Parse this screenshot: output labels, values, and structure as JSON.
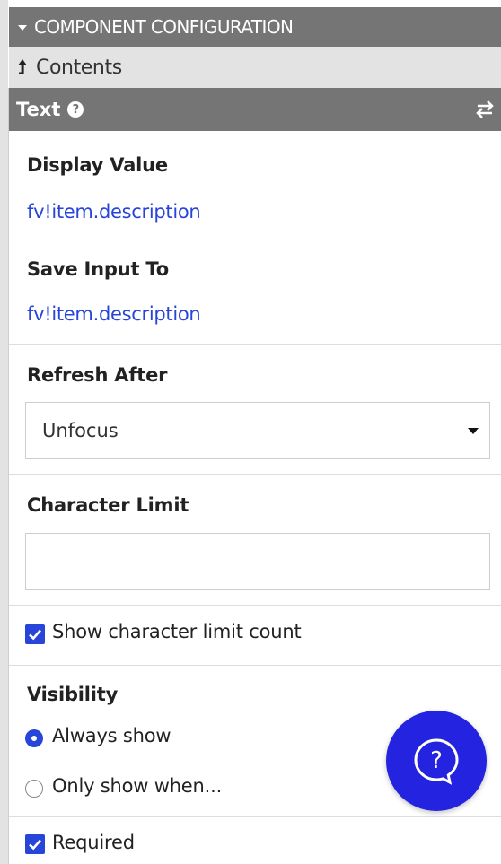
{
  "header": {
    "title": "COMPONENT CONFIGURATION"
  },
  "breadcrumb": {
    "contents_label": "Contents"
  },
  "component": {
    "name": "Text"
  },
  "fields": {
    "display_value": {
      "label": "Display Value",
      "value": "fv!item.description"
    },
    "save_input_to": {
      "label": "Save Input To",
      "value": "fv!item.description"
    },
    "refresh_after": {
      "label": "Refresh After",
      "selected": "Unfocus"
    },
    "character_limit": {
      "label": "Character Limit",
      "value": "",
      "show_count_label": "Show character limit count",
      "show_count_checked": true
    },
    "visibility": {
      "label": "Visibility",
      "options": [
        {
          "label": "Always show",
          "selected": true
        },
        {
          "label": "Only show when...",
          "selected": false
        }
      ]
    },
    "required": {
      "label": "Required",
      "checked": true
    }
  },
  "colors": {
    "header_bg": "#757575",
    "band_bg": "#e3e3e3",
    "accent": "#2845d9",
    "fab_bg": "#2323e0"
  },
  "icons": {
    "header_caret": "caret-down-icon",
    "contents_arrow": "arrow-up-icon",
    "component_help": "question-circle-icon",
    "component_swap": "swap-icon",
    "dropdown": "caret-down-icon",
    "fab": "help-chat-icon"
  }
}
